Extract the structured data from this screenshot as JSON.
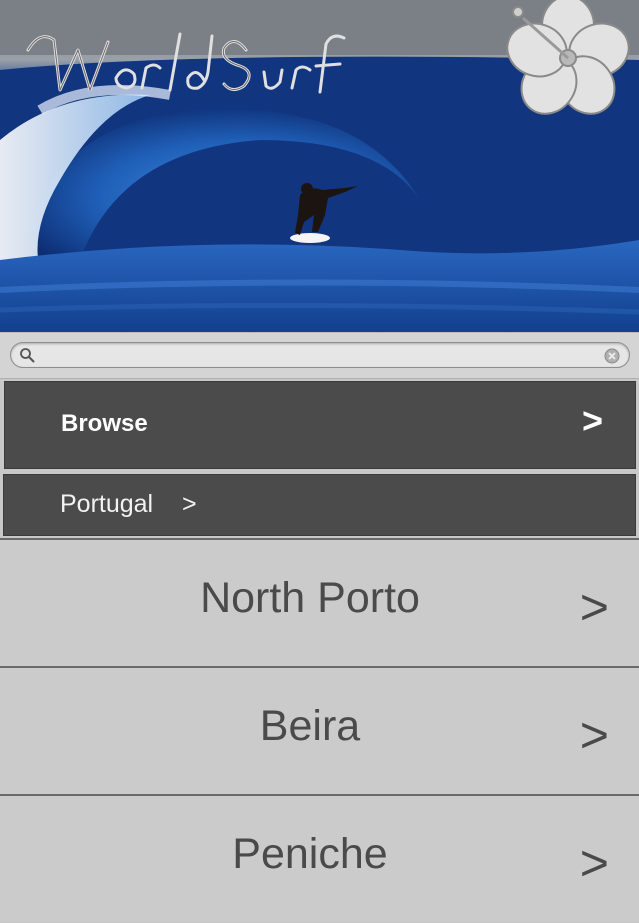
{
  "header": {
    "logo_text": "World Surf"
  },
  "search": {
    "value": "",
    "placeholder": "",
    "icon": "search-icon",
    "clear_icon": "clear-icon"
  },
  "browse": {
    "label": "Browse",
    "chevron": ">"
  },
  "breadcrumb": {
    "label": "Portugal",
    "chevron": ">"
  },
  "list": {
    "items": [
      {
        "label": "North Porto",
        "chevron": ">"
      },
      {
        "label": "Beira",
        "chevron": ">"
      },
      {
        "label": "Peniche",
        "chevron": ">"
      }
    ]
  },
  "colors": {
    "dark_row": "#4b4b4b",
    "list_bg": "#cbcbcb",
    "list_text": "#4a4a4a",
    "ocean": "#1a4fa0"
  }
}
